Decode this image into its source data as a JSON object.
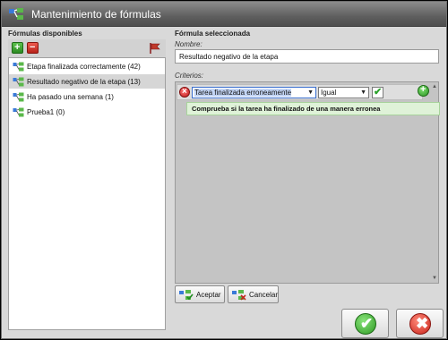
{
  "window": {
    "title": "Mantenimiento de fórmulas"
  },
  "left": {
    "header": "Fórmulas disponibles",
    "items": [
      {
        "label": "Etapa finalizada correctamente (42)"
      },
      {
        "label": "Resultado negativo de la etapa (13)"
      },
      {
        "label": "Ha pasado una semana (1)"
      },
      {
        "label": "Prueba1 (0)"
      }
    ],
    "selected_index": 1
  },
  "right": {
    "header": "Fórmula seleccionada",
    "name_label": "Nombre:",
    "name_value": "Resultado negativo de la etapa",
    "criteria_label": "Criterios:",
    "criterion": {
      "field": "Tarea finalizada erroneamente",
      "operator": "Igual",
      "value_checked": true,
      "description": "Comprueba si la tarea ha finalizado de una manera erronea"
    },
    "accept_label": "Aceptar",
    "cancel_label": "Cancelar"
  },
  "icons": {
    "add": "plus-icon",
    "remove": "minus-icon",
    "flag": "flag-icon",
    "formula": "formula-icon",
    "ok": "checkmark-icon",
    "cancel": "cross-icon"
  },
  "colors": {
    "titlebar": "#5f5f5f",
    "ok": "#2e9a24",
    "cancel": "#c8231a",
    "description_bg": "#dff2d8"
  }
}
